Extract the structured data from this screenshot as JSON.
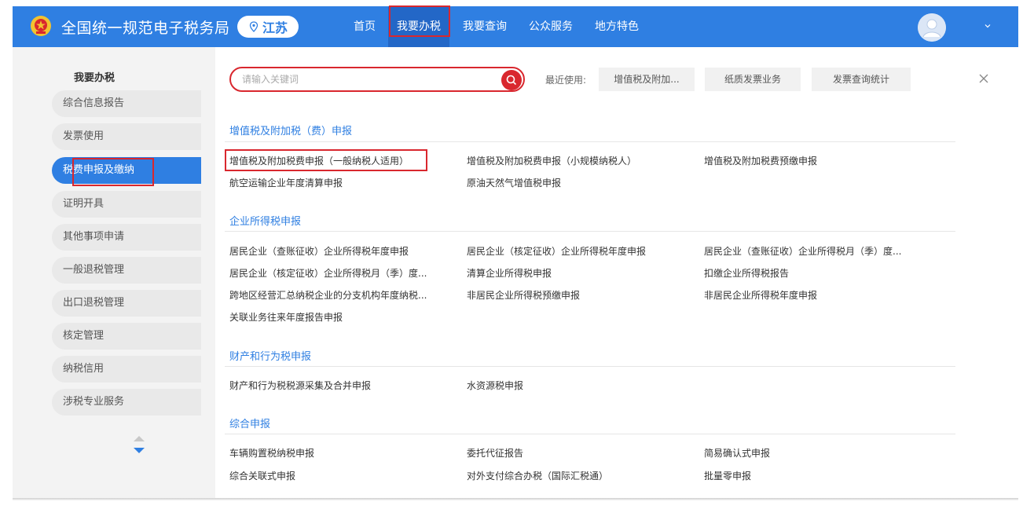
{
  "header": {
    "site_title": "全国统一规范电子税务局",
    "region": "江苏",
    "nav": [
      "首页",
      "我要办税",
      "我要查询",
      "公众服务",
      "地方特色"
    ],
    "active_nav": "我要办税",
    "brand_color": "#2f7fe2"
  },
  "sidebar": {
    "title": "我要办税",
    "items": [
      "综合信息报告",
      "发票使用",
      "税费申报及缴纳",
      "证明开具",
      "其他事项申请",
      "一般退税管理",
      "出口退税管理",
      "核定管理",
      "纳税信用",
      "涉税专业服务"
    ],
    "active_item": "税费申报及缴纳"
  },
  "search": {
    "placeholder": "请输入关键词",
    "recent_label": "最近使用:",
    "recent": [
      "增值税及附加...",
      "纸质发票业务",
      "发票查询统计"
    ]
  },
  "sections": [
    {
      "title": "增值税及附加税（费）申报",
      "links": [
        "增值税及附加税费申报（一般纳税人适用）",
        "增值税及附加税费申报（小规模纳税人）",
        "增值税及附加税费预缴申报",
        "航空运输企业年度清算申报",
        "原油天然气增值税申报"
      ]
    },
    {
      "title": "企业所得税申报",
      "links": [
        "居民企业（查账征收）企业所得税年度申报",
        "居民企业（核定征收）企业所得税年度申报",
        "居民企业（查账征收）企业所得税月（季）度...",
        "居民企业（核定征收）企业所得税月（季）度...",
        "清算企业所得税申报",
        "扣缴企业所得税报告",
        "跨地区经营汇总纳税企业的分支机构年度纳税...",
        "非居民企业所得税预缴申报",
        "非居民企业所得税年度申报",
        "关联业务往来年度报告申报"
      ]
    },
    {
      "title": "财产和行为税申报",
      "links": [
        "财产和行为税税源采集及合并申报",
        "水资源税申报"
      ]
    },
    {
      "title": "综合申报",
      "links": [
        "车辆购置税纳税申报",
        "委托代征报告",
        "简易确认式申报",
        "综合关联式申报",
        "对外支付综合办税（国际汇税通）",
        "批量零申报"
      ]
    }
  ]
}
